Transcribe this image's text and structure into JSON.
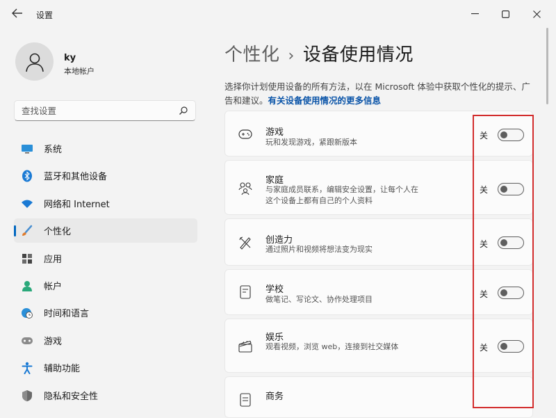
{
  "window": {
    "title": "设置",
    "controls": [
      "minimize-icon",
      "maximize-icon",
      "close-icon"
    ]
  },
  "profile": {
    "name": "ky",
    "account_type": "本地帐户"
  },
  "search": {
    "placeholder": "查找设置",
    "value": ""
  },
  "sidebar": {
    "items": [
      {
        "label": "系统",
        "icon": "monitor-icon",
        "selected": false
      },
      {
        "label": "蓝牙和其他设备",
        "icon": "bluetooth-icon",
        "selected": false
      },
      {
        "label": "网络和 Internet",
        "icon": "wifi-icon",
        "selected": false
      },
      {
        "label": "个性化",
        "icon": "brush-icon",
        "selected": true
      },
      {
        "label": "应用",
        "icon": "apps-icon",
        "selected": false
      },
      {
        "label": "帐户",
        "icon": "person-icon",
        "selected": false
      },
      {
        "label": "时间和语言",
        "icon": "globe-clock-icon",
        "selected": false
      },
      {
        "label": "游戏",
        "icon": "gamepad-icon",
        "selected": false
      },
      {
        "label": "辅助功能",
        "icon": "accessibility-icon",
        "selected": false
      },
      {
        "label": "隐私和安全性",
        "icon": "shield-icon",
        "selected": false
      }
    ]
  },
  "main": {
    "breadcrumb_parent": "个性化",
    "breadcrumb_separator": "›",
    "page_title": "设备使用情况",
    "description": "选择你计划使用设备的所有方法，以在 Microsoft 体验中获取个性化的提示、广告和建议。",
    "description_link": "有关设备使用情况的更多信息",
    "cards": [
      {
        "title": "游戏",
        "description": "玩和发现游戏，紧跟新版本",
        "icon": "game-controller-icon",
        "state": "关",
        "enabled": false
      },
      {
        "title": "家庭",
        "description": "与家庭成员联系，编辑安全设置，让每个人在这个设备上都有自己的个人资料",
        "icon": "family-icon",
        "state": "关",
        "enabled": false
      },
      {
        "title": "创造力",
        "description": "通过照片和视频将想法变为现实",
        "icon": "pen-ruler-icon",
        "state": "关",
        "enabled": false
      },
      {
        "title": "学校",
        "description": "做笔记、写论文、协作处理项目",
        "icon": "notebook-icon",
        "state": "关",
        "enabled": false
      },
      {
        "title": "娱乐",
        "description": "观看视频，浏览 web，连接到社交媒体",
        "icon": "clapperboard-icon",
        "state": "关",
        "enabled": false
      },
      {
        "title": "商务",
        "description": "",
        "icon": "document-icon",
        "state": "",
        "enabled": false
      }
    ]
  },
  "colors": {
    "accent": "#0067c0",
    "highlight_box": "#d22c2c",
    "background": "#f3f3f3",
    "card": "#fbfbfb"
  }
}
